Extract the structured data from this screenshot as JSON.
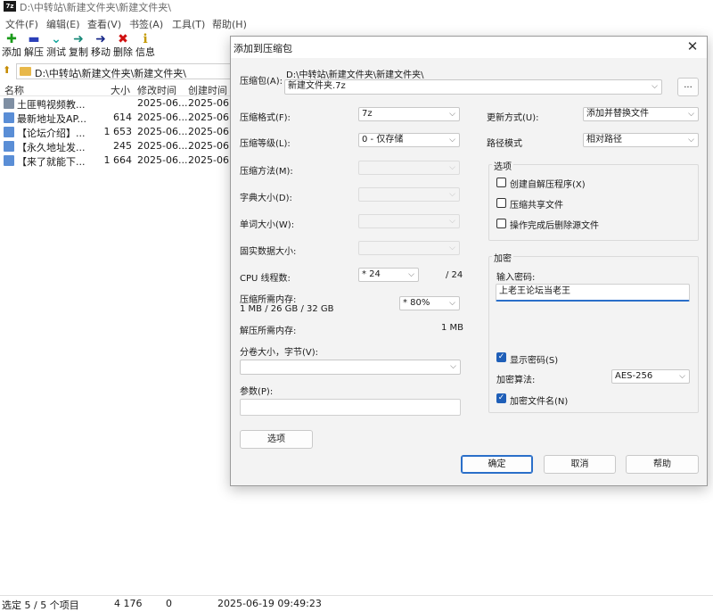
{
  "window": {
    "title": "D:\\中转站\\新建文件夹\\新建文件夹\\",
    "app_icon": "7z"
  },
  "menu": [
    "文件(F)",
    "编辑(E)",
    "查看(V)",
    "书签(A)",
    "工具(T)",
    "帮助(H)"
  ],
  "toolbar": {
    "add": {
      "label": "添加",
      "icon": "plus-icon",
      "color": "#1a9a1a"
    },
    "extract": {
      "label": "解压",
      "icon": "minus-icon",
      "color": "#2a3fb8"
    },
    "test": {
      "label": "测试",
      "icon": "check-chevron-icon",
      "color": "#19a8a0"
    },
    "copy": {
      "label": "复制",
      "icon": "arrow-right-icon",
      "color": "#1a8a7a"
    },
    "move": {
      "label": "移动",
      "icon": "arrow-right-icon",
      "color": "#1a2a8a"
    },
    "delete": {
      "label": "删除",
      "icon": "x-icon",
      "color": "#d01010"
    },
    "info": {
      "label": "信息",
      "icon": "info-icon",
      "color": "#c49a00"
    }
  },
  "address": {
    "path": "D:\\中转站\\新建文件夹\\新建文件夹\\"
  },
  "columns": {
    "name": "名称",
    "size": "大小",
    "modified": "修改时间",
    "created": "创建时间"
  },
  "files": [
    {
      "name": "土匪鸭视频教...",
      "size": "",
      "modified": "2025-06...",
      "created": "2025-06...",
      "type": "folder"
    },
    {
      "name": "最新地址及AP...",
      "size": "614",
      "modified": "2025-06...",
      "created": "2025-06...",
      "type": "doc"
    },
    {
      "name": "【论坛介绍】...",
      "size": "1 653",
      "modified": "2025-06...",
      "created": "2025-06...",
      "type": "doc"
    },
    {
      "name": "【永久地址发...",
      "size": "245",
      "modified": "2025-06...",
      "created": "2025-06...",
      "type": "doc"
    },
    {
      "name": "【来了就能下...",
      "size": "1 664",
      "modified": "2025-06...",
      "created": "2025-06...",
      "type": "doc"
    }
  ],
  "status": {
    "selection": "选定 5 / 5 个项目",
    "size": "4 176",
    "packed": "0",
    "date": "2025-06-19 09:49:23"
  },
  "dialog": {
    "title": "添加到压缩包",
    "archive_label": "压缩包(A):",
    "archive_dir": "D:\\中转站\\新建文件夹\\新建文件夹\\",
    "archive_name": "新建文件夹.7z",
    "browse_label": "...",
    "format_label": "压缩格式(F):",
    "format_value": "7z",
    "level_label": "压缩等级(L):",
    "level_value": "0 - 仅存储",
    "method_label": "压缩方法(M):",
    "dict_label": "字典大小(D):",
    "word_label": "单词大小(W):",
    "solid_label": "固实数据大小:",
    "threads_label": "CPU 线程数:",
    "threads_value": "* 24",
    "threads_total": "/ 24",
    "mem_label": "压缩所需内存:",
    "mem_value": "1 MB / 26 GB / 32 GB",
    "mem_percent": "* 80%",
    "decomp_mem_label": "解压所需内存:",
    "decomp_mem_value": "1 MB",
    "volume_label": "分卷大小，字节(V):",
    "volume_value": "",
    "params_label": "参数(P):",
    "params_value": "",
    "options_button": "选项",
    "update_label": "更新方式(U):",
    "update_value": "添加并替换文件",
    "path_mode_label": "路径模式",
    "path_mode_value": "相对路径",
    "options_group": "选项",
    "opt_sfx": {
      "label": "创建自解压程序(X)",
      "checked": false
    },
    "opt_shared": {
      "label": "压缩共享文件",
      "checked": false
    },
    "opt_delete": {
      "label": "操作完成后删除源文件",
      "checked": false
    },
    "encrypt_group": "加密",
    "pwd_label": "输入密码:",
    "pwd_value": "上老王论坛当老王",
    "show_pwd": {
      "label": "显示密码(S)",
      "checked": true
    },
    "enc_method_label": "加密算法:",
    "enc_method_value": "AES-256",
    "enc_names": {
      "label": "加密文件名(N)",
      "checked": true
    },
    "ok": "确定",
    "cancel": "取消",
    "help": "帮助"
  }
}
